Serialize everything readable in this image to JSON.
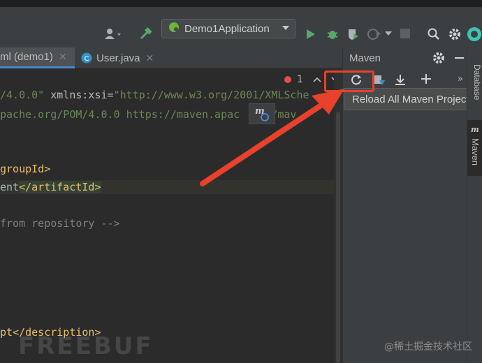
{
  "toolbar": {
    "run_config": "Demo1Application",
    "icons": [
      "user-icon",
      "build-hammer-icon",
      "run-icon",
      "debug-icon",
      "coverage-icon",
      "profile-icon",
      "stop-icon",
      "search-icon",
      "settings-icon"
    ]
  },
  "tabs": [
    {
      "label": "ml (demo1)",
      "active": true
    },
    {
      "label": "User.java",
      "active": false
    }
  ],
  "editor": {
    "lines": {
      "l1a": "/4.0.0\"",
      "l1b": " xmlns:xsi=",
      "l1c": "\"http://www.w3.org/2001/XMLSche",
      "l2": "pache.org/POM/4.0.0 https://maven.apac",
      "l2b": "     /mav",
      "l3a": "groupId",
      "l3b": ">",
      "l4a": "ent",
      "l4b": "</artifactId>",
      "l5": "from repository -->",
      "l6a": "pt",
      "l6b": "</description>"
    },
    "inspection_count": "1"
  },
  "maven": {
    "title": "Maven",
    "tooltip": "Reload All Maven Projects",
    "side_tab_database": "Database",
    "side_tab_maven": "Maven"
  },
  "watermark": {
    "logo": "FREEBUF",
    "credit": "@稀土掘金技术社区"
  },
  "colors": {
    "highlight": "#e8412c",
    "run_green": "#59a869",
    "accent_blue": "#4a88c7"
  }
}
